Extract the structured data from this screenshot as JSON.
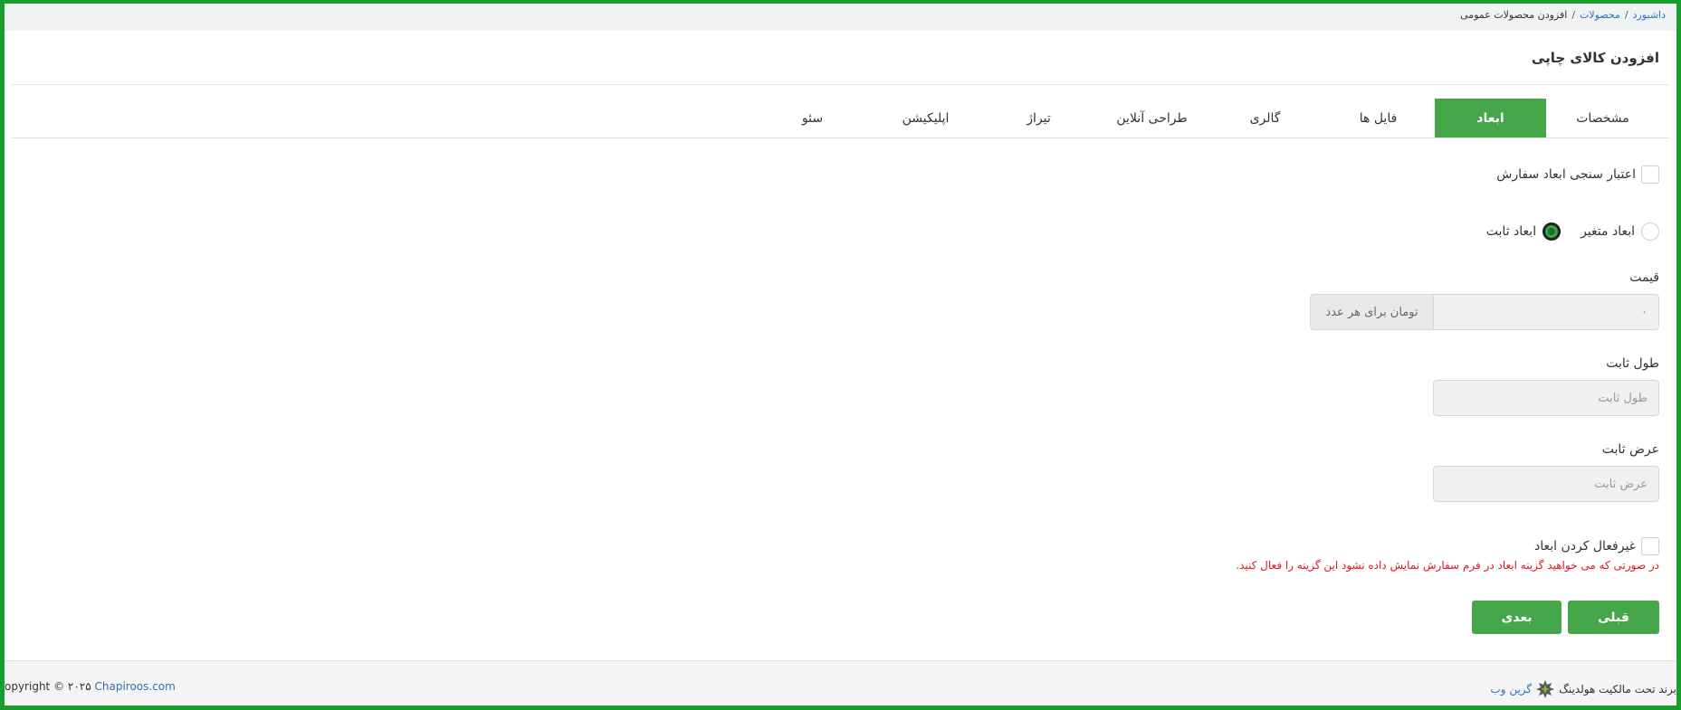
{
  "breadcrumb": {
    "items": [
      "داشبورد",
      "محصولات"
    ],
    "separator": "/",
    "current": "افزودن محصولات عمومی"
  },
  "page": {
    "title": "افزودن کالای چاپی"
  },
  "tabs": [
    {
      "label": "مشخصات",
      "active": false
    },
    {
      "label": "ابعاد",
      "active": true
    },
    {
      "label": "فایل ها",
      "active": false
    },
    {
      "label": "گالری",
      "active": false
    },
    {
      "label": "طراحی آنلاین",
      "active": false
    },
    {
      "label": "تیراژ",
      "active": false
    },
    {
      "label": "اپلیکیشن",
      "active": false
    },
    {
      "label": "سئو",
      "active": false
    }
  ],
  "form": {
    "validate_dimensions_label": "اعتبار سنجی ابعاد سفارش",
    "variable_dimensions_label": "ابعاد متغیر",
    "fixed_dimensions_label": "ابعاد ثابت",
    "price_label": "قیمت",
    "price_value": "۰",
    "price_addon": "تومان برای هر عدد",
    "fixed_length_label": "طول ثابت",
    "fixed_length_placeholder": "طول ثابت",
    "fixed_width_label": "عرض ثابت",
    "fixed_width_placeholder": "عرض ثابت",
    "disable_dimensions_label": "غیرفعال کردن ابعاد",
    "warning": "در صورتی که می خواهید گزینه ابعاد در فرم سفارش نمایش داده نشود این گزینه را فعال کنید."
  },
  "buttons": {
    "prev": "قبلی",
    "next": "بعدی"
  },
  "footer": {
    "copyright_prefix": "opyright © ۲۰۲۵",
    "site_link": "Chapiroos.com",
    "brand_text": "برند تحت مالکیت هولدینگ",
    "brand_link": "گرین وب"
  },
  "colors": {
    "accent": "#45a749",
    "frame": "#1a9c2e",
    "warning": "#e0161c",
    "link": "#2f6fc1"
  }
}
